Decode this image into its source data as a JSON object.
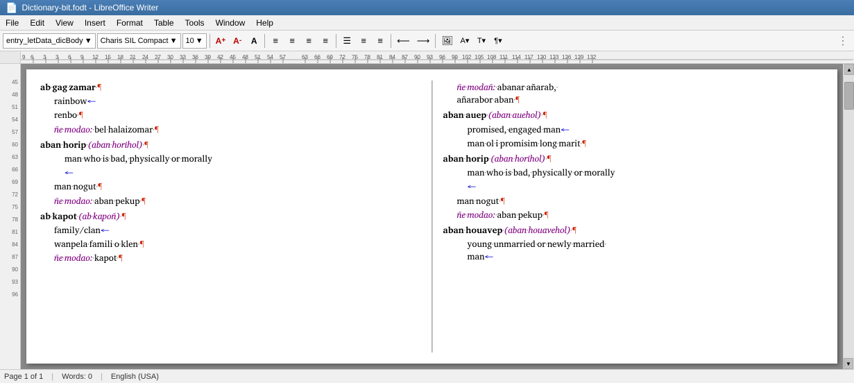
{
  "titlebar": {
    "title": "Dictionary-bit.fodt - LibreOffice Writer",
    "icon": "📄"
  },
  "menubar": {
    "items": [
      "File",
      "Edit",
      "View",
      "Insert",
      "Format",
      "Table",
      "Tools",
      "Window",
      "Help"
    ]
  },
  "toolbar1": {
    "style_dropdown": "entry_letData_dicBody",
    "font_dropdown": "Charis SIL Compact",
    "size_dropdown": "10",
    "buttons": [
      "A+",
      "A-",
      "A",
      "≡",
      "≡",
      "≡",
      "≡",
      "≡",
      "≡",
      "≡",
      "≡",
      "⊞",
      "⊟",
      "🖼",
      "A▼",
      "T▼",
      "≡▼"
    ]
  },
  "ruler": {
    "marks": [
      9,
      6,
      3,
      3,
      6,
      9,
      12,
      15,
      18,
      21,
      24,
      27,
      30,
      33,
      36,
      39,
      42,
      45,
      48,
      51,
      54,
      57,
      63,
      66,
      69,
      72,
      75,
      78,
      81,
      84,
      87,
      90,
      93,
      96,
      99,
      102,
      105,
      108,
      111,
      114,
      117,
      120,
      123,
      126,
      129,
      132
    ]
  },
  "left_col": {
    "entries": [
      {
        "type": "main",
        "text": "ab·gag·zamar·¶",
        "bold": true
      },
      {
        "type": "sub",
        "text": "rainbow←"
      },
      {
        "type": "sub",
        "text": "renbo·¶"
      },
      {
        "type": "sub",
        "text": "ñe·modao:·bel·halaizomar·¶",
        "modao": true
      },
      {
        "type": "main",
        "text": "aban·horip·(aban·horihol)·¶",
        "bold": true,
        "italic_part": "(aban·horihol)"
      },
      {
        "type": "sub2",
        "text": "man·who·is·bad,·physically·or·morally"
      },
      {
        "type": "sub2",
        "text": "←"
      },
      {
        "type": "sub",
        "text": "man·nogut·¶"
      },
      {
        "type": "sub",
        "text": "ñe·modao:·aban·pekup·¶",
        "modao": true
      },
      {
        "type": "main",
        "text": "ab·kapot·(ab·kapoñ)·¶",
        "bold": true,
        "italic_part": "(ab·kapoñ)"
      },
      {
        "type": "sub",
        "text": "family/clan←"
      },
      {
        "type": "sub",
        "text": "wanpela·famili·o·klen·¶"
      },
      {
        "type": "sub",
        "text": "ñe·modao:·kapot·¶",
        "modao": true
      }
    ]
  },
  "right_col": {
    "entries": [
      {
        "type": "sub",
        "text": "ñe·modañ:·abanar·añarab,·añarabor·aban·¶",
        "modao": true
      },
      {
        "type": "main",
        "text": "aban·auep·(aban·auehol)·¶",
        "bold": true,
        "italic_part": "(aban·auehol)"
      },
      {
        "type": "sub2",
        "text": "promised,·engaged·man←"
      },
      {
        "type": "sub2",
        "text": "man·ol·i·promisim·long·marit·¶"
      },
      {
        "type": "main",
        "text": "aban·horip·(aban·horihol)·¶",
        "bold": true,
        "italic_part": "(aban·horihol)"
      },
      {
        "type": "sub2",
        "text": "man·who·is·bad,·physically·or·morally"
      },
      {
        "type": "sub2",
        "text": "←"
      },
      {
        "type": "sub",
        "text": "man·nogut·¶"
      },
      {
        "type": "sub",
        "text": "ñe·modao:·aban·pekup·¶",
        "modao": true
      },
      {
        "type": "main",
        "text": "aban·houavep·(aban·houavehol)·¶",
        "bold": true,
        "italic_part": "(aban·houavehol)"
      },
      {
        "type": "sub2",
        "text": "young·unmarried·or·newly·married·man←"
      }
    ]
  },
  "statusbar": {
    "page_info": "Page 1 of 1",
    "words": "Words: 0",
    "lang": "English (USA)"
  }
}
